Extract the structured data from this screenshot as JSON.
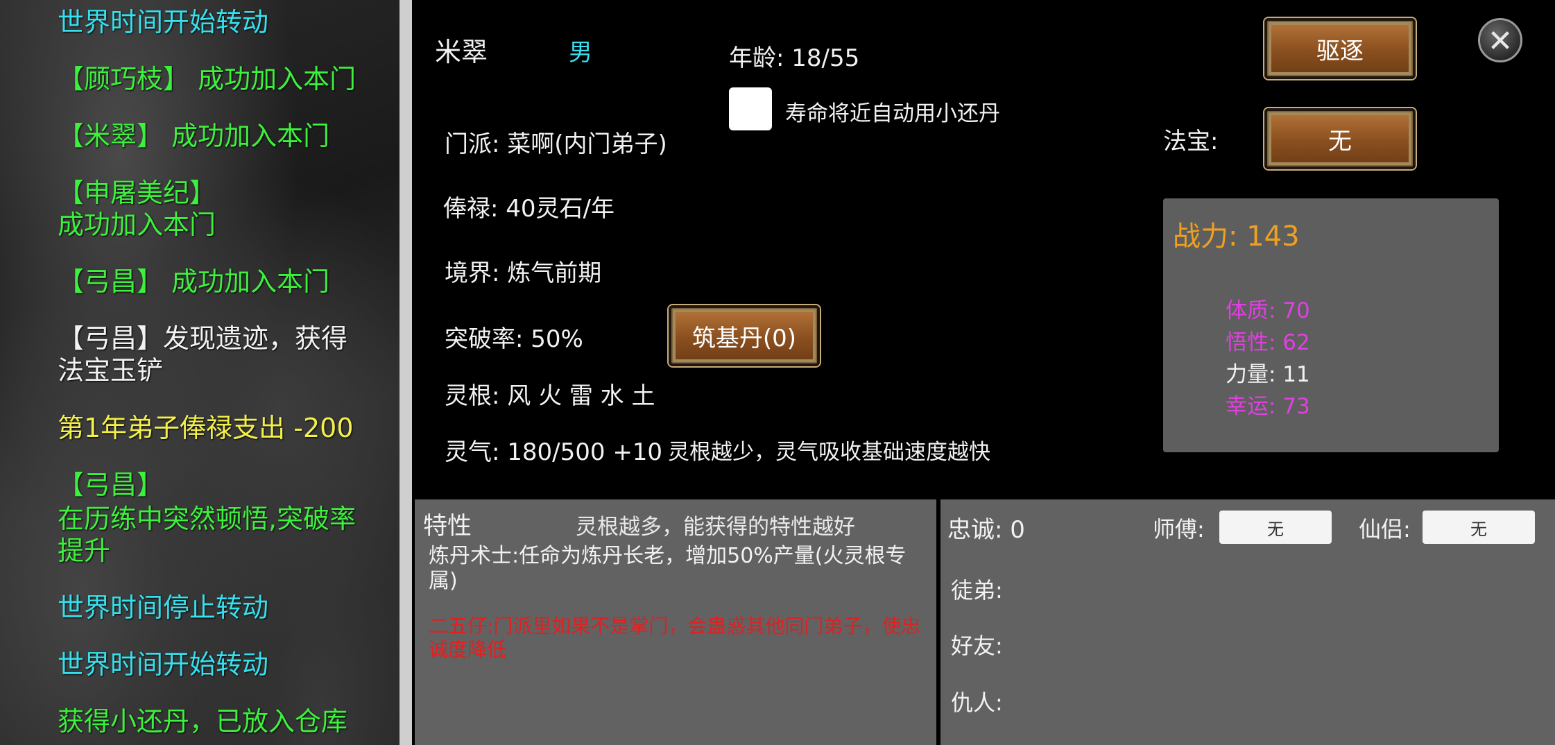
{
  "log": {
    "entries": [
      {
        "text": "世界时间开始转动",
        "color": "cyan"
      },
      {
        "text": "【顾巧枝】 成功加入本门",
        "color": "green"
      },
      {
        "text": "【米翠】 成功加入本门",
        "color": "green"
      },
      {
        "text": "【申屠美纪】",
        "color": "green"
      },
      {
        "text": "成功加入本门",
        "color": "green"
      },
      {
        "text": "【弓昌】 成功加入本门",
        "color": "green"
      },
      {
        "text": "【弓昌】发现遗迹，获得",
        "color": "white"
      },
      {
        "text": "法宝玉铲",
        "color": "white"
      },
      {
        "text": "第1年弟子俸禄支出 -200",
        "color": "yellow"
      },
      {
        "text": "【弓昌】",
        "color": "green"
      },
      {
        "text": "在历练中突然顿悟,突破率",
        "color": "green"
      },
      {
        "text": "提升",
        "color": "green"
      },
      {
        "text": "世界时间停止转动",
        "color": "cyan"
      },
      {
        "text": "世界时间开始转动",
        "color": "cyan"
      },
      {
        "text": "获得小还丹，已放入仓库",
        "color": "green"
      }
    ]
  },
  "disciple": {
    "name": "米翠",
    "gender": "男",
    "age": "年龄: 18/55",
    "auto_pill_label": "寿命将近自动用小还丹",
    "sect": "门派: 菜啊(内门弟子)",
    "salary": "俸禄: 40灵石/年",
    "realm": "境界: 炼气前期",
    "breakthrough": "突破率:  50%",
    "foundation_pill_button": "筑基丹(0)",
    "spirit_roots": "灵根: 风 火 雷 水 土",
    "spirit_qi": "灵气: 180/500 +10",
    "spirit_qi_hint": "灵根越少，灵气吸收基础速度越快",
    "expel_button": "驱逐",
    "treasure_label": "法宝:",
    "treasure_button": "无",
    "close_icon": "close-icon"
  },
  "power": {
    "title": "战力: 143",
    "stats": [
      {
        "text": "体质: 70",
        "color": "#e040e0"
      },
      {
        "text": "悟性: 62",
        "color": "#e040e0"
      },
      {
        "text": "力量: 11",
        "color": "#f2f2f2"
      },
      {
        "text": "幸运: 73",
        "color": "#e040e0"
      }
    ]
  },
  "traits": {
    "title": "特性",
    "hint": "灵根越多，能获得的特性越好",
    "trait1": "炼丹术士:任命为炼丹长老，增加50%产量(火灵根专属)",
    "trait2": "二五仔:门派里如果不是掌门，会蛊惑其他同门弟子，使忠诚度降低"
  },
  "relations": {
    "loyalty": "忠诚: 0",
    "master_label": "师傅:",
    "master_value": "无",
    "partner_label": "仙侣:",
    "partner_value": "无",
    "apprentice_label": "徒弟:",
    "friend_label": "好友:",
    "enemy_label": "仇人:"
  },
  "colors": {
    "cyan": "#36e0ee",
    "green": "#3ef03e",
    "white": "#f2f2f2",
    "yellow": "#f3f04a",
    "gender": "#36e0ee",
    "power_title": "#f0a020",
    "bad_trait": "#e02020"
  }
}
